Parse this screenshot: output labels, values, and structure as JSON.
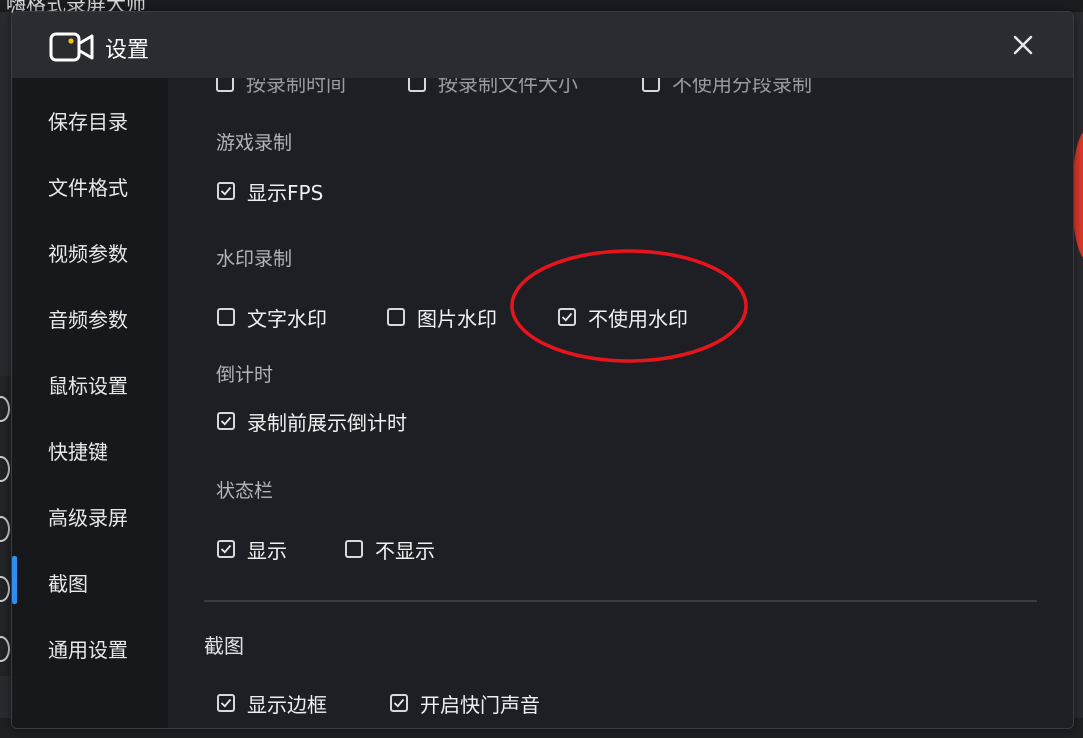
{
  "background": {
    "app_title": "嗨格式录屏大师"
  },
  "dialog": {
    "title": "设置",
    "close_glyph": "✕"
  },
  "sidebar": {
    "items": [
      {
        "label": "保存目录"
      },
      {
        "label": "文件格式"
      },
      {
        "label": "视频参数"
      },
      {
        "label": "音频参数"
      },
      {
        "label": "鼠标设置"
      },
      {
        "label": "快捷键"
      },
      {
        "label": "高级录屏",
        "active": true
      },
      {
        "label": "截图"
      },
      {
        "label": "通用设置"
      }
    ]
  },
  "content": {
    "cut_row": [
      "按录制时间",
      "按录制文件大小",
      "不使用分段录制"
    ],
    "game_recording": {
      "title": "游戏录制",
      "show_fps": {
        "label": "显示FPS",
        "checked": true
      }
    },
    "watermark_recording": {
      "title": "水印录制",
      "options": [
        {
          "label": "文字水印",
          "checked": false
        },
        {
          "label": "图片水印",
          "checked": false
        },
        {
          "label": "不使用水印",
          "checked": true
        }
      ]
    },
    "countdown": {
      "title": "倒计时",
      "show_countdown": {
        "label": "录制前展示倒计时",
        "checked": true
      }
    },
    "status_bar": {
      "title": "状态栏",
      "options": [
        {
          "label": "显示",
          "checked": true
        },
        {
          "label": "不显示",
          "checked": false
        }
      ]
    },
    "screenshot": {
      "title": "截图",
      "options": [
        {
          "label": "显示边框",
          "checked": true
        },
        {
          "label": "开启快门声音",
          "checked": true
        }
      ]
    }
  },
  "colors": {
    "accent": "#2f8cf0",
    "highlight": "#e8141c",
    "dialog_bg": "#1e1f24",
    "sidebar_bg": "#17181c"
  }
}
